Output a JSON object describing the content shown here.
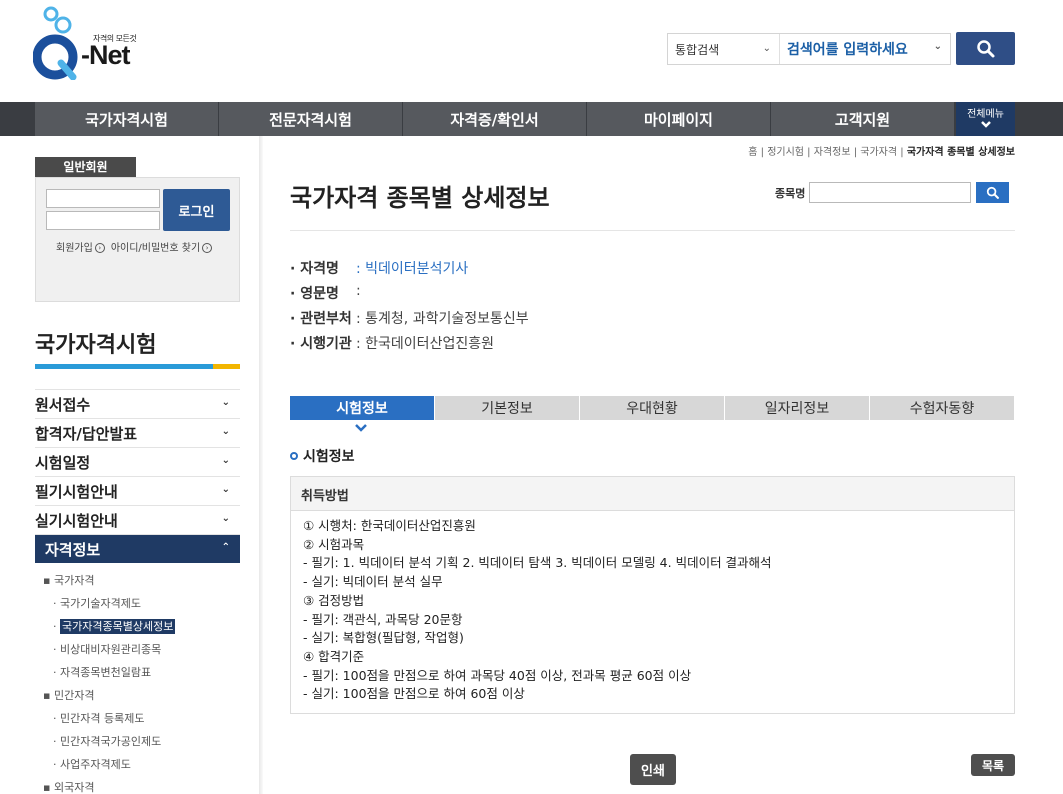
{
  "header": {
    "logo_tagline": "자격의 모든것",
    "logo_word": "-Net",
    "search_select": "통합검색",
    "search_placeholder": "검색어를 입력하세요",
    "allmenu_label": "전체메뉴"
  },
  "gnb": [
    "국가자격시험",
    "전문자격시험",
    "자격증/확인서",
    "마이페이지",
    "고객지원"
  ],
  "login": {
    "tab": "일반회원",
    "button": "로그인",
    "join": "회원가입",
    "find": "아이디/비밀번호 찾기"
  },
  "sidebar": {
    "title": "국가자격시험",
    "menus": [
      "원서접수",
      "합격자/답안발표",
      "시험일정",
      "필기시험안내",
      "실기시험안내",
      "자격정보"
    ],
    "sub": [
      {
        "level": 1,
        "label": "국가자격"
      },
      {
        "level": 2,
        "label": "국가기술자격제도"
      },
      {
        "level": 2,
        "label": "국가자격종목별상세정보",
        "current": true
      },
      {
        "level": 2,
        "label": "비상대비자원관리종목"
      },
      {
        "level": 2,
        "label": "자격종목변천일람표"
      },
      {
        "level": 1,
        "label": "민간자격"
      },
      {
        "level": 2,
        "label": "민간자격 등록제도"
      },
      {
        "level": 2,
        "label": "민간자격국가공인제도"
      },
      {
        "level": 2,
        "label": "사업주자격제도"
      },
      {
        "level": 1,
        "label": "외국자격"
      }
    ]
  },
  "breadcrumb": [
    "홈",
    "정기시험",
    "자격정보",
    "국가자격",
    "국가자격 종목별 상세정보"
  ],
  "page": {
    "title": "국가자격 종목별 상세정보",
    "item_search_label": "종목명"
  },
  "info": [
    {
      "key": "· 자격명",
      "value": ": 빅데이터분석기사",
      "link": true
    },
    {
      "key": "· 영문명",
      "value": ":"
    },
    {
      "key": "· 관련부처",
      "value": ": 통계청, 과학기술정보통신부"
    },
    {
      "key": "· 시행기관",
      "value": ": 한국데이터산업진흥원"
    }
  ],
  "tabs": [
    "시험정보",
    "기본정보",
    "우대현황",
    "일자리정보",
    "수험자동향"
  ],
  "section_title": "시험정보",
  "panel": {
    "head": "취득방법",
    "lines": [
      "① 시행처: 한국데이터산업진흥원",
      "② 시험과목",
      " - 필기: 1. 빅데이터 분석 기획  2. 빅데이터 탐색  3. 빅데이터 모델링  4. 빅데이터 결과해석",
      " - 실기: 빅데이터 분석 실무",
      "③ 검정방법",
      " - 필기: 객관식, 과목당 20문항",
      " - 실기: 복합형(필답형, 작업형)",
      "④ 합격기준",
      " - 필기: 100점을 만점으로 하여 과목당 40점 이상, 전과목 평균 60점 이상",
      " - 실기: 100점을 만점으로 하여 60점 이상"
    ]
  },
  "buttons": {
    "print": "인쇄",
    "list": "목록"
  }
}
